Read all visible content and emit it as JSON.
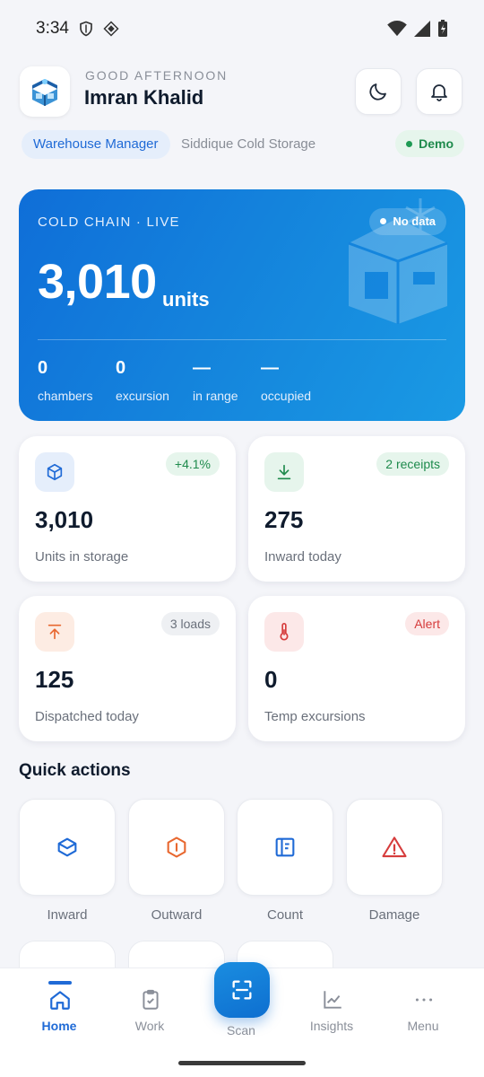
{
  "status_bar": {
    "time": "3:34"
  },
  "header": {
    "greeting": "GOOD AFTERNOON",
    "user_name": "Imran Khalid",
    "role": "Warehouse Manager",
    "facility": "Siddique Cold Storage",
    "mode_badge": "Demo"
  },
  "hero": {
    "kicker": "COLD CHAIN · LIVE",
    "status": "No data",
    "total": "3,010",
    "unit": "units",
    "stats": [
      {
        "value": "0",
        "label": "chambers"
      },
      {
        "value": "0",
        "label": "excursion"
      },
      {
        "value": "—",
        "label": "in range"
      },
      {
        "value": "—",
        "label": "occupied"
      }
    ]
  },
  "cards": [
    {
      "icon": "box-icon",
      "badge": "+4.1%",
      "value": "3,010",
      "label": "Units in storage",
      "color": "#1f6ad6"
    },
    {
      "icon": "download-icon",
      "badge": "2 receipts",
      "value": "275",
      "label": "Inward today",
      "color": "#1e8a4c"
    },
    {
      "icon": "upload-icon",
      "badge": "3 loads",
      "value": "125",
      "label": "Dispatched today",
      "color": "#e8672f"
    },
    {
      "icon": "thermometer-icon",
      "badge": "Alert",
      "value": "0",
      "label": "Temp excursions",
      "color": "#d63c3c"
    }
  ],
  "quick_actions": {
    "title": "Quick actions",
    "items": [
      {
        "label": "Inward",
        "icon": "box-icon"
      },
      {
        "label": "Outward",
        "icon": "box-out-icon"
      },
      {
        "label": "Count",
        "icon": "count-icon"
      },
      {
        "label": "Damage",
        "icon": "warning-icon"
      }
    ]
  },
  "nav": {
    "items": [
      {
        "label": "Home",
        "icon": "home-icon"
      },
      {
        "label": "Work",
        "icon": "clipboard-icon"
      },
      {
        "label": "Scan",
        "icon": "scan-icon"
      },
      {
        "label": "Insights",
        "icon": "chart-icon"
      },
      {
        "label": "Menu",
        "icon": "more-icon"
      }
    ]
  }
}
